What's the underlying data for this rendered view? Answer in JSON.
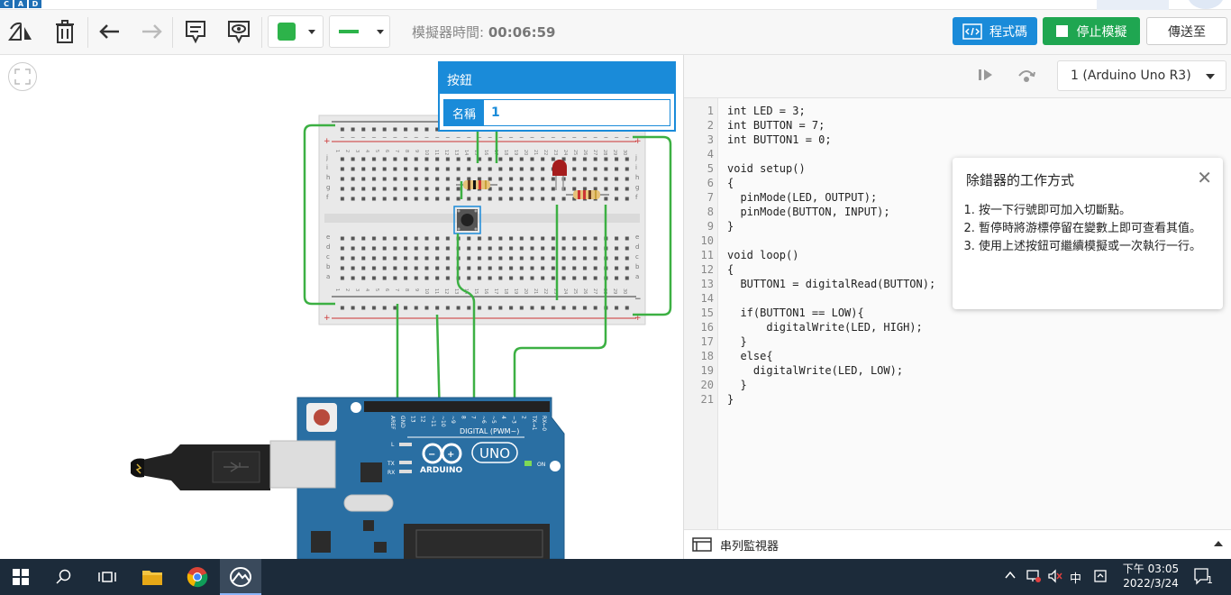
{
  "brand": {
    "logo_letters": [
      "C",
      "A",
      "D"
    ]
  },
  "toolbar": {
    "sim_time_label": "模擬器時間:",
    "sim_time_value": "00:06:59",
    "code_button": "程式碼",
    "stop_button": "停止模擬",
    "send_button": "傳送至",
    "color_swatch": "#2db34a",
    "wire_color": "#2db34a"
  },
  "popup": {
    "title": "按鈕",
    "name_label": "名稱",
    "name_value": "1"
  },
  "breadboard": {
    "col_numbers": [
      "1",
      "2",
      "3",
      "4",
      "5",
      "6",
      "7",
      "8",
      "9",
      "10",
      "11",
      "12",
      "13",
      "14",
      "15",
      "16",
      "17",
      "18",
      "19",
      "20",
      "21",
      "22",
      "23",
      "24",
      "25",
      "26",
      "27",
      "28",
      "29",
      "30"
    ],
    "row_letters_top": [
      "j",
      "i",
      "h",
      "g",
      "f"
    ],
    "row_letters_bottom": [
      "e",
      "d",
      "c",
      "b",
      "a"
    ],
    "plus": "+",
    "minus": "−"
  },
  "arduino": {
    "digital_label": "DIGITAL (PWM~)",
    "uno": "UNO",
    "brand": "ARDUINO",
    "on": "ON",
    "pin_labels": [
      "AREF",
      "GND",
      "13",
      "12",
      "~11",
      "~10",
      "~9",
      "8",
      "7",
      "~6",
      "~5",
      "4",
      "~3",
      "2",
      "TX→1",
      "RX←0"
    ],
    "leds": [
      "L",
      "TX",
      "RX"
    ]
  },
  "right_panel": {
    "device": "1 (Arduino Uno R3)",
    "serial_monitor": "串列監視器",
    "line_numbers": [
      "1",
      "2",
      "3",
      "4",
      "5",
      "6",
      "7",
      "8",
      "9",
      "10",
      "11",
      "12",
      "13",
      "14",
      "15",
      "16",
      "17",
      "18",
      "19",
      "20",
      "21"
    ],
    "code_lines": [
      "int LED = 3;",
      "int BUTTON = 7;",
      "int BUTTON1 = 0;",
      "",
      "void setup()",
      "{",
      "  pinMode(LED, OUTPUT);",
      "  pinMode(BUTTON, INPUT);",
      "}",
      "",
      "void loop()",
      "{",
      "  BUTTON1 = digitalRead(BUTTON);",
      "",
      "  if(BUTTON1 == LOW){",
      "      digitalWrite(LED, HIGH);",
      "  }",
      "  else{",
      "    digitalWrite(LED, LOW);",
      "  }",
      "}"
    ],
    "help": {
      "title": "除錯器的工作方式",
      "items": [
        "按一下行號即可加入切斷點。",
        "暫停時將游標停留在變數上即可查看其值。",
        "使用上述按鈕可繼續模擬或一次執行一行。"
      ]
    }
  },
  "taskbar": {
    "ime": "中",
    "time_period": "下午 03:05",
    "date": "2022/3/24",
    "notifications": "1"
  }
}
